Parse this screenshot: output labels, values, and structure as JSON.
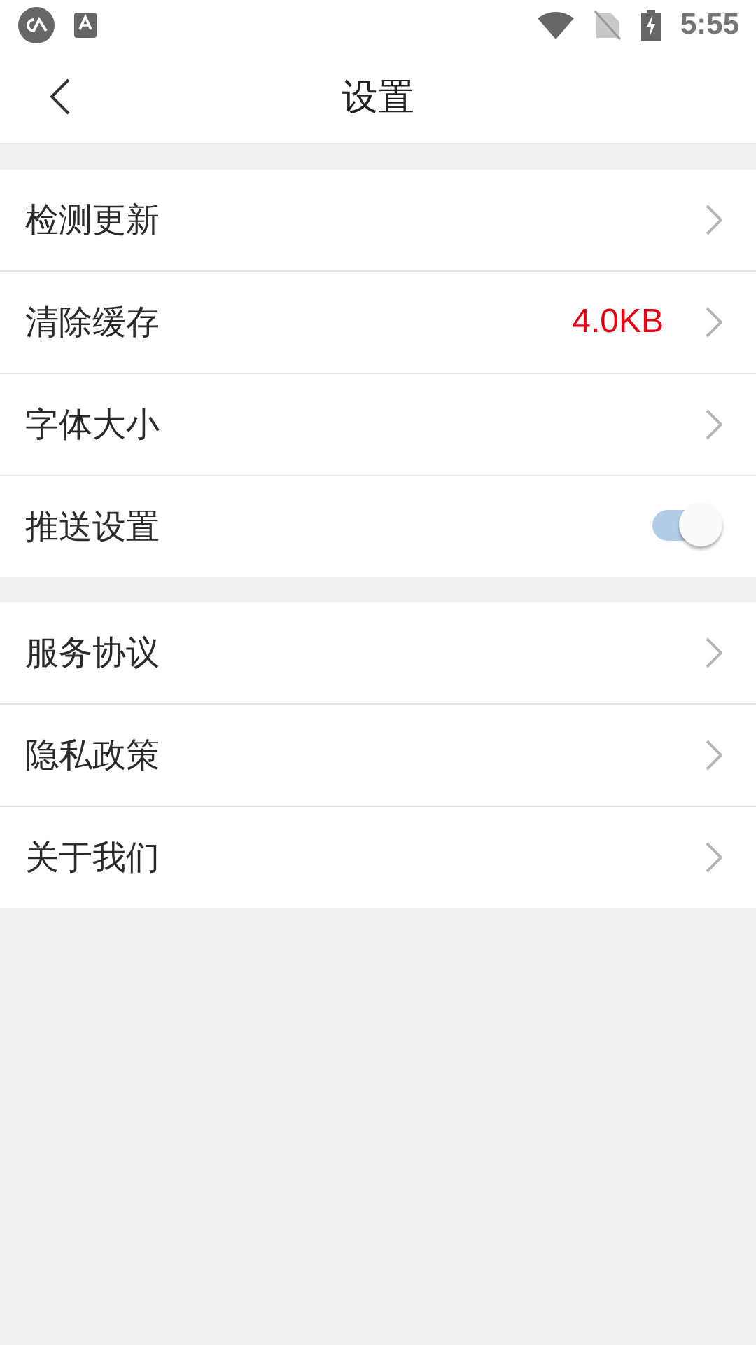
{
  "status_bar": {
    "time": "5:55"
  },
  "header": {
    "title": "设置"
  },
  "groups": [
    {
      "items": [
        {
          "kind": "link",
          "label": "检测更新"
        },
        {
          "kind": "link",
          "label": "清除缓存",
          "value": "4.0KB"
        },
        {
          "kind": "link",
          "label": "字体大小"
        },
        {
          "kind": "toggle",
          "label": "推送设置",
          "on": true
        }
      ]
    },
    {
      "items": [
        {
          "kind": "link",
          "label": "服务协议"
        },
        {
          "kind": "link",
          "label": "隐私政策"
        },
        {
          "kind": "link",
          "label": "关于我们"
        }
      ]
    }
  ]
}
